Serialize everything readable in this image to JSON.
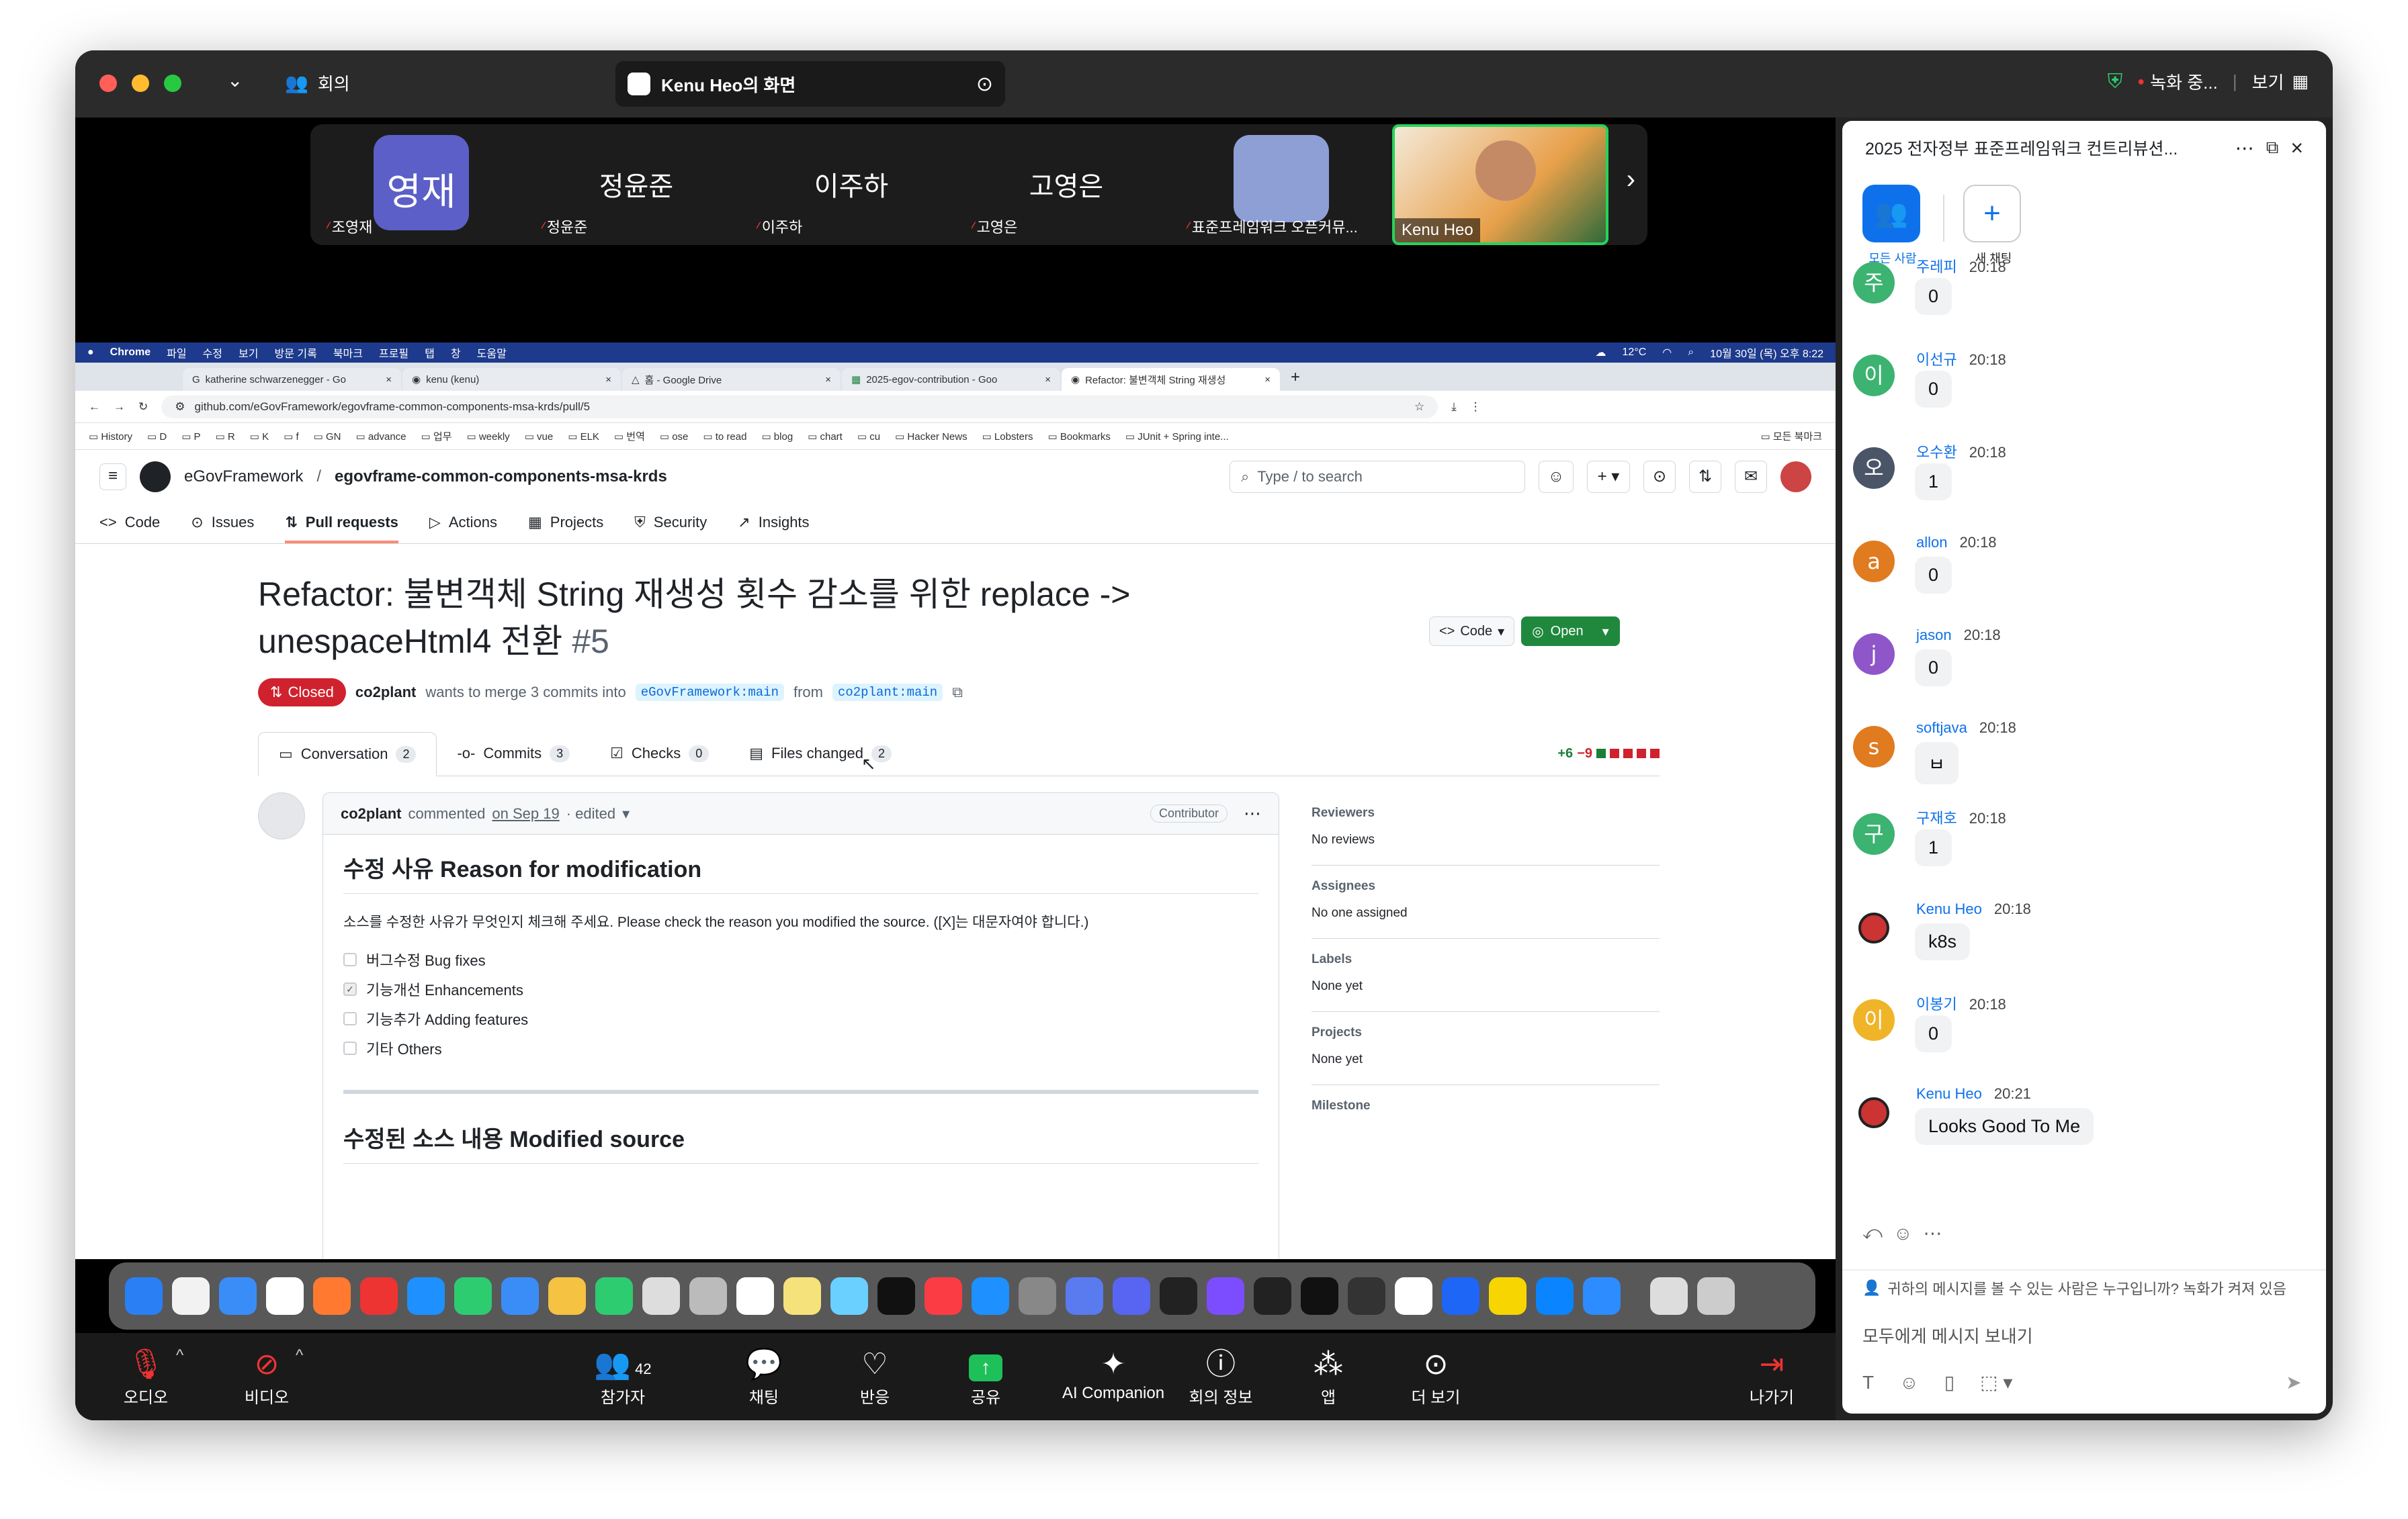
{
  "zoom_top": {
    "meeting_label": "회의",
    "screen_title": "Kenu Heo의 화면",
    "recording": "녹화 중...",
    "view_label": "보기"
  },
  "participants": [
    {
      "display": "영재",
      "name": "조영재",
      "color": "#5b5fc7"
    },
    {
      "display": "정윤준",
      "name": "정윤준",
      "color": ""
    },
    {
      "display": "이주하",
      "name": "이주하",
      "color": ""
    },
    {
      "display": "고영은",
      "name": "고영은",
      "color": ""
    },
    {
      "display": "",
      "name": "표준프레임워크 오픈커뮤...",
      "color": "#8e9fd6"
    },
    {
      "display": "",
      "name": "Kenu Heo",
      "color": ""
    }
  ],
  "mac_menu": [
    "Chrome",
    "파일",
    "수정",
    "보기",
    "방문 기록",
    "북마크",
    "프로필",
    "탭",
    "창",
    "도움말"
  ],
  "mac_status": {
    "weather": "12°C",
    "datetime": "10월 30일 (목) 오후 8:22"
  },
  "browser_tabs": [
    {
      "label": "katherine schwarzenegger - Go",
      "active": false
    },
    {
      "label": "kenu (kenu)",
      "active": false
    },
    {
      "label": "홈 - Google Drive",
      "active": false
    },
    {
      "label": "2025-egov-contribution - Goo",
      "active": false
    },
    {
      "label": "Refactor: 불변객체 String 재생성",
      "active": true
    }
  ],
  "url": "github.com/eGovFramework/egovframe-common-components-msa-krds/pull/5",
  "bookmarks": [
    "History",
    "D",
    "P",
    "R",
    "K",
    "f",
    "GN",
    "advance",
    "업무",
    "weekly",
    "vue",
    "ELK",
    "번역",
    "ose",
    "to read",
    "blog",
    "chart",
    "cu",
    "Hacker News",
    "Lobsters",
    "Bookmarks",
    "JUnit + Spring inte...",
    "모든 북마크"
  ],
  "github": {
    "owner": "eGovFramework",
    "repo": "egovframe-common-components-msa-krds",
    "search_placeholder": "Type / to search",
    "nav": [
      "Code",
      "Issues",
      "Pull requests",
      "Actions",
      "Projects",
      "Security",
      "Insights"
    ],
    "pr_title_line1": "Refactor: 불변객체 String 재생성 횟수 감소를 위한 replace ->",
    "pr_title_line2": "unespaceHtml4 전환",
    "pr_number": "#5",
    "code_button": "Code",
    "open_button": "Open",
    "state": "Closed",
    "author": "co2plant",
    "merge_text": "wants to merge 3 commits into",
    "base_branch": "eGovFramework:main",
    "from_text": "from",
    "head_branch": "co2plant:main",
    "tabs": [
      {
        "label": "Conversation",
        "count": "2"
      },
      {
        "label": "Commits",
        "count": "3"
      },
      {
        "label": "Checks",
        "count": "0"
      },
      {
        "label": "Files changed",
        "count": "2"
      }
    ],
    "additions": "+6",
    "deletions": "−9",
    "comment": {
      "author": "co2plant",
      "action": "commented",
      "date": "on Sep 19",
      "edited": "· edited",
      "role": "Contributor",
      "heading1": "수정 사유 Reason for modification",
      "instruction": "소스를 수정한 사유가 무엇인지 체크해 주세요. Please check the reason you modified the source. ([X]는 대문자여야 합니다.)",
      "checkboxes": [
        {
          "label": "버그수정 Bug fixes",
          "checked": false
        },
        {
          "label": "기능개선 Enhancements",
          "checked": true
        },
        {
          "label": "기능추가 Adding features",
          "checked": false
        },
        {
          "label": "기타 Others",
          "checked": false
        }
      ],
      "heading2": "수정된 소스 내용 Modified source"
    },
    "sidebar": [
      {
        "title": "Reviewers",
        "value": "No reviews"
      },
      {
        "title": "Assignees",
        "value": "No one assigned"
      },
      {
        "title": "Labels",
        "value": "None yet"
      },
      {
        "title": "Projects",
        "value": "None yet"
      },
      {
        "title": "Milestone",
        "value": ""
      }
    ]
  },
  "toolbar": [
    {
      "label": "오디오",
      "icon": "mic-off"
    },
    {
      "label": "비디오",
      "icon": "video-off"
    },
    {
      "label": "참가자",
      "icon": "participants",
      "count": "42"
    },
    {
      "label": "채팅",
      "icon": "chat"
    },
    {
      "label": "반응",
      "icon": "heart"
    },
    {
      "label": "공유",
      "icon": "share"
    },
    {
      "label": "AI Companion",
      "icon": "sparkle"
    },
    {
      "label": "회의 정보",
      "icon": "info"
    },
    {
      "label": "앱",
      "icon": "apps"
    },
    {
      "label": "더 보기",
      "icon": "more"
    },
    {
      "label": "나가기",
      "icon": "leave"
    }
  ],
  "chat": {
    "title": "2025 전자정부 표준프레임워크 컨트리뷰션...",
    "everyone_label": "모든 사람",
    "new_chat_label": "새 채팅",
    "messages": [
      {
        "name": "주레피",
        "time": "20:18",
        "text": "0",
        "initial": "주",
        "color": "#3cb371"
      },
      {
        "name": "이선규",
        "time": "20:18",
        "text": "0",
        "initial": "이",
        "color": "#3cb371"
      },
      {
        "name": "오수환",
        "time": "20:18",
        "text": "1",
        "initial": "오",
        "color": "#4a5568"
      },
      {
        "name": "allon",
        "time": "20:18",
        "text": "0",
        "initial": "a",
        "color": "#e07b20"
      },
      {
        "name": "jason",
        "time": "20:18",
        "text": "0",
        "initial": "j",
        "color": "#8e56c9"
      },
      {
        "name": "softjava",
        "time": "20:18",
        "text": "ㅂ",
        "initial": "s",
        "color": "#e07b20"
      },
      {
        "name": "구재호",
        "time": "20:18",
        "text": "1",
        "initial": "구",
        "color": "#3cb371"
      },
      {
        "name": "Kenu Heo",
        "time": "20:18",
        "text": "k8s",
        "initial": "",
        "color": ""
      },
      {
        "name": "이봉기",
        "time": "20:18",
        "text": "0",
        "initial": "이",
        "color": "#f0b429"
      },
      {
        "name": "Kenu Heo",
        "time": "20:21",
        "text": "Looks Good To Me",
        "initial": "",
        "color": ""
      }
    ],
    "visibility_note": "귀하의 메시지를 볼 수 있는 사람은 누구입니까? 녹화가 켜져 있음",
    "input_placeholder": "모두에게 메시지 보내기"
  }
}
